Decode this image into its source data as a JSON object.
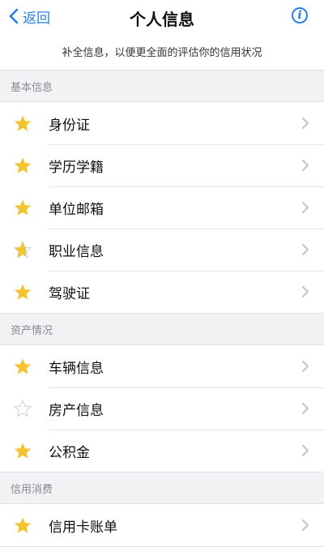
{
  "nav": {
    "back_label": "返回",
    "title": "个人信息"
  },
  "subtitle": "补全信息，以便更全面的评估你的信用状况",
  "colors": {
    "accent": "#2a7fe6",
    "star_filled": "#f4c430",
    "star_empty": "#d9d9dc"
  },
  "sections": [
    {
      "header": "基本信息",
      "items": [
        {
          "label": "身份证",
          "status": "filled"
        },
        {
          "label": "学历学籍",
          "status": "filled"
        },
        {
          "label": "单位邮箱",
          "status": "filled"
        },
        {
          "label": "职业信息",
          "status": "partial"
        },
        {
          "label": "驾驶证",
          "status": "filled"
        }
      ]
    },
    {
      "header": "资产情况",
      "items": [
        {
          "label": "车辆信息",
          "status": "filled"
        },
        {
          "label": "房产信息",
          "status": "empty"
        },
        {
          "label": "公积金",
          "status": "filled"
        }
      ]
    },
    {
      "header": "信用消费",
      "items": [
        {
          "label": "信用卡账单",
          "status": "filled"
        }
      ]
    }
  ]
}
